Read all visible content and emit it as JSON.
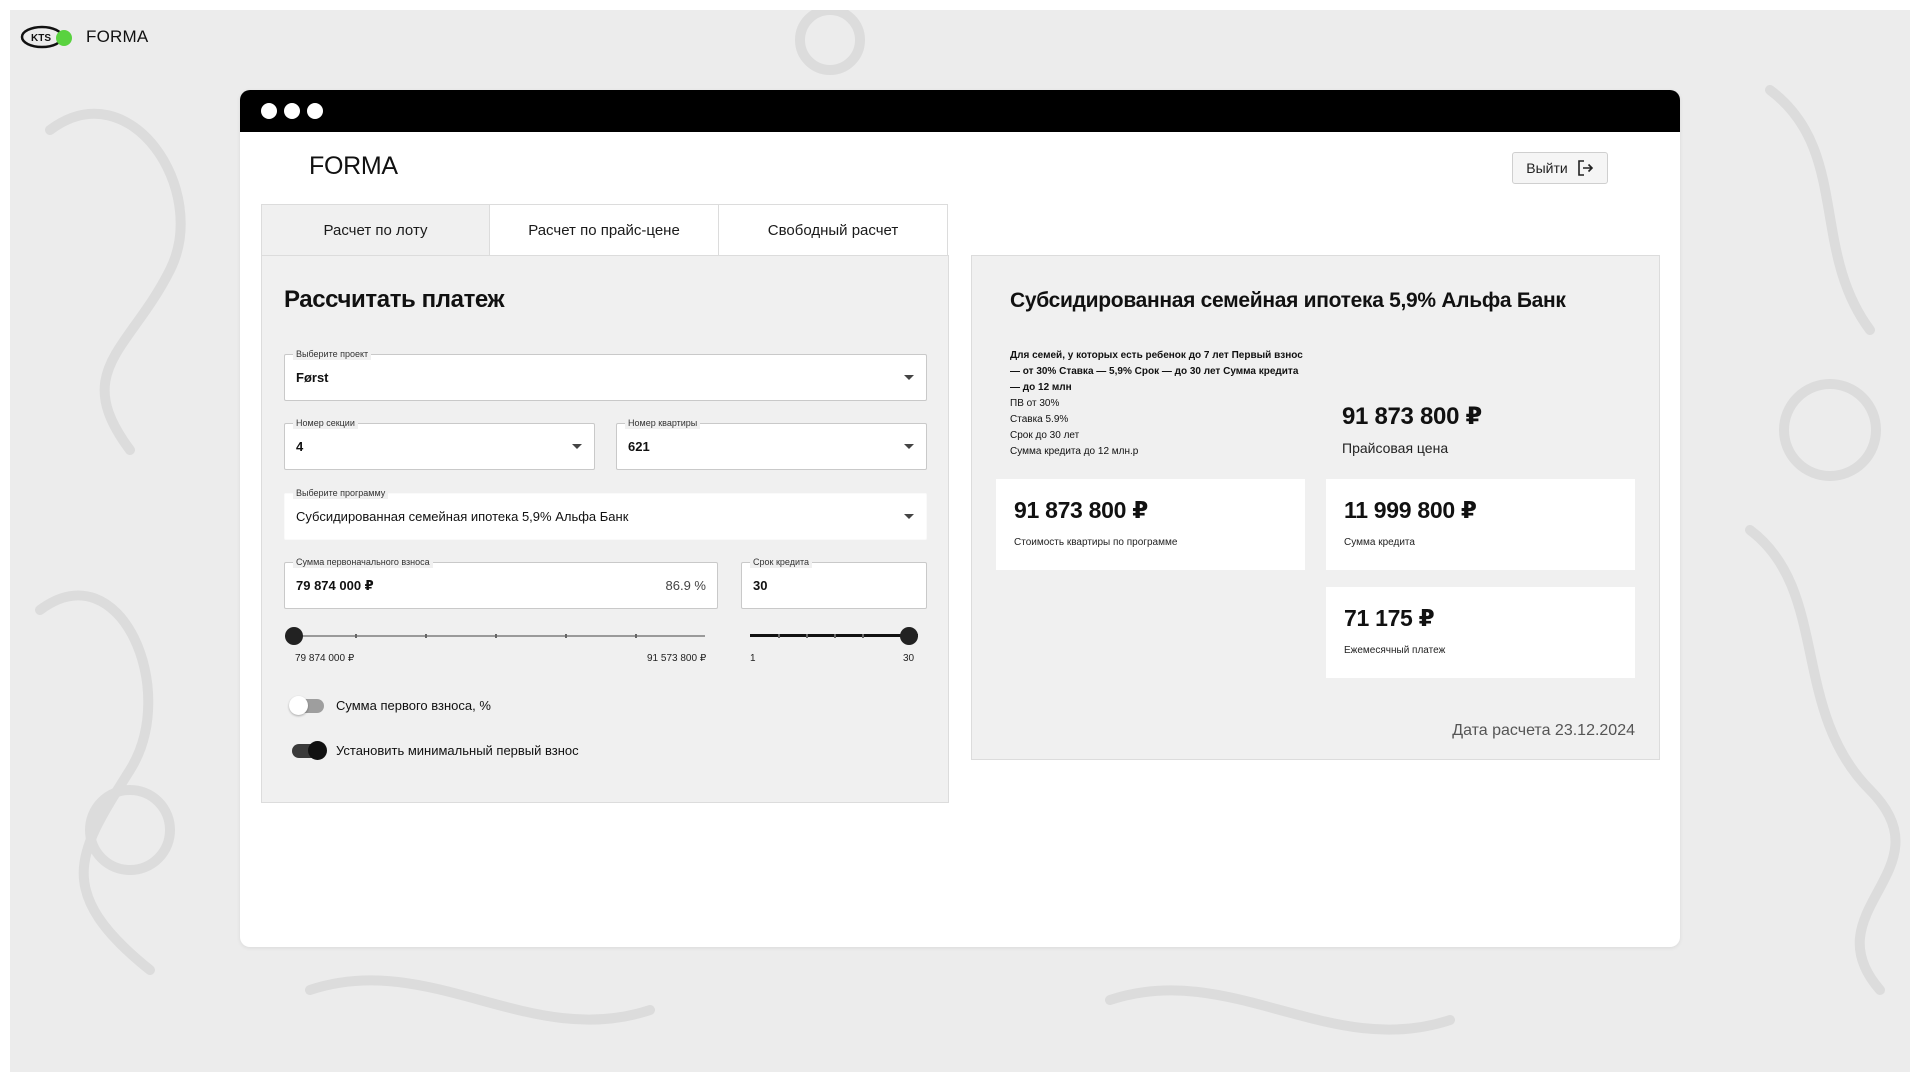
{
  "brand": {
    "outer_name": "FORMA",
    "logo_icon": "kts-logo-icon",
    "app_name": "FORMA"
  },
  "header": {
    "logout_label": "Выйти",
    "logout_icon": "logout-icon"
  },
  "tabs": [
    {
      "label": "Расчет по лоту",
      "active": true
    },
    {
      "label": "Расчет по прайс-цене",
      "active": false
    },
    {
      "label": "Свободный расчет",
      "active": false
    }
  ],
  "form": {
    "title": "Рассчитать платеж",
    "project": {
      "legend": "Выберите проект",
      "value": "Først"
    },
    "section": {
      "legend": "Номер секции",
      "value": "4"
    },
    "apartment": {
      "legend": "Номер квартиры",
      "value": "621"
    },
    "program": {
      "legend": "Выберите программу",
      "value": "Субсидированная семейная ипотека 5,9% Альфа Банк"
    },
    "down_payment": {
      "legend": "Сумма первоначального взноса",
      "value": "79 874 000 ₽",
      "percent": "86.9 %"
    },
    "term": {
      "legend": "Срок кредита",
      "value": "30"
    },
    "down_slider": {
      "min_label": "79 874 000 ₽",
      "max_label": "91 573 800 ₽",
      "position": 0
    },
    "term_slider": {
      "min_label": "1",
      "max_label": "30",
      "position": 1
    },
    "toggle_percent": {
      "label": "Сумма первого взноса, %",
      "on": false
    },
    "toggle_min": {
      "label": "Установить минимальный первый взнос",
      "on": true
    }
  },
  "result": {
    "title": "Субсидированная семейная ипотека 5,9% Альфа Банк",
    "description_bold": "Для семей, у которых есть ребенок до 7 лет Первый взнос — от 30% Ставка — 5,9% Срок — до 30 лет Сумма кредита — до 12 млн",
    "description_lines": [
      "ПВ от 30%",
      "Ставка 5.9%",
      "Срок до 30 лет",
      "Сумма кредита до 12 млн.р"
    ],
    "price": {
      "amount": "91 873 800 ₽",
      "label": "Прайсовая цена"
    },
    "cards": [
      {
        "amount": "91 873 800 ₽",
        "label": "Стоимость квартиры по программе"
      },
      {
        "amount": "11 999 800 ₽",
        "label": "Сумма кредита"
      },
      {
        "amount": "71 175 ₽",
        "label": "Ежемесячный платеж"
      }
    ],
    "calc_date": "Дата расчета 23.12.2024"
  }
}
